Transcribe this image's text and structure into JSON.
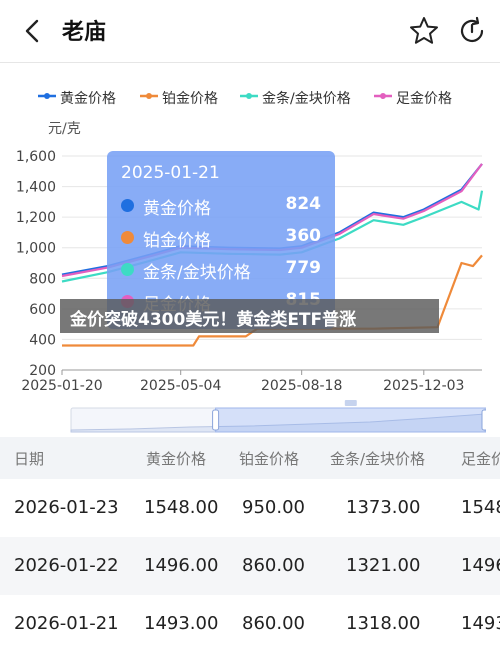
{
  "header": {
    "title": "老庙",
    "back_icon": "back-chevron-icon",
    "favorite_icon": "star-icon",
    "refresh_icon": "refresh-icon"
  },
  "legend": [
    {
      "label": "黄金价格",
      "color": "#1f6fe0"
    },
    {
      "label": "铂金价格",
      "color": "#ef8a3a"
    },
    {
      "label": "金条/金块价格",
      "color": "#3ddbc4"
    },
    {
      "label": "足金价格",
      "color": "#e35fbf"
    }
  ],
  "chart_data": {
    "type": "line",
    "ylabel": "元/克",
    "ylim": [
      200,
      1600
    ],
    "yticks": [
      "200",
      "400",
      "600",
      "800",
      "1,000",
      "1,200",
      "1,400",
      "1,600"
    ],
    "xticks": [
      "2025-01-20",
      "2025-05-04",
      "2025-08-18",
      "2025-12-03"
    ],
    "grid": true,
    "series": [
      {
        "name": "黄金价格",
        "color": "#1f6fe0",
        "x": [
          "2025-01-20",
          "2025-03-01",
          "2025-04-10",
          "2025-05-04",
          "2025-06-15",
          "2025-07-30",
          "2025-08-18",
          "2025-09-20",
          "2025-10-20",
          "2025-11-15",
          "2025-12-03",
          "2026-01-05",
          "2026-01-23"
        ],
        "values": [
          824,
          880,
          960,
          1010,
          1000,
          995,
          1010,
          1100,
          1230,
          1200,
          1250,
          1380,
          1548
        ]
      },
      {
        "name": "铂金价格",
        "color": "#ef8a3a",
        "x": [
          "2025-01-20",
          "2025-05-15",
          "2025-05-20",
          "2025-06-30",
          "2025-07-10",
          "2025-10-20",
          "2025-12-15",
          "2025-12-20",
          "2026-01-05",
          "2026-01-15",
          "2026-01-23"
        ],
        "values": [
          360,
          360,
          420,
          420,
          470,
          470,
          480,
          580,
          900,
          880,
          950
        ]
      },
      {
        "name": "金条/金块价格",
        "color": "#3ddbc4",
        "x": [
          "2025-01-20",
          "2025-03-01",
          "2025-04-10",
          "2025-05-04",
          "2025-06-15",
          "2025-07-30",
          "2025-08-18",
          "2025-09-20",
          "2025-10-20",
          "2025-11-15",
          "2025-12-03",
          "2026-01-05",
          "2026-01-20",
          "2026-01-23"
        ],
        "values": [
          779,
          840,
          920,
          970,
          960,
          955,
          970,
          1060,
          1180,
          1150,
          1200,
          1300,
          1250,
          1373
        ]
      },
      {
        "name": "足金价格",
        "color": "#e35fbf",
        "x": [
          "2025-01-20",
          "2025-03-01",
          "2025-04-10",
          "2025-05-04",
          "2025-06-15",
          "2025-07-30",
          "2025-08-18",
          "2025-09-20",
          "2025-10-20",
          "2025-11-15",
          "2025-12-03",
          "2026-01-05",
          "2026-01-23"
        ],
        "values": [
          815,
          870,
          950,
          1000,
          990,
          985,
          1000,
          1090,
          1220,
          1190,
          1240,
          1370,
          1548
        ]
      }
    ]
  },
  "tooltip": {
    "date": "2025-01-21",
    "rows": [
      {
        "label": "黄金价格",
        "value": "824",
        "color": "#1f6fe0"
      },
      {
        "label": "铂金价格",
        "value": "360",
        "color": "#ef8a3a"
      },
      {
        "label": "金条/金块价格",
        "value": "779",
        "color": "#3ddbc4"
      },
      {
        "label": "足金价格",
        "value": "815",
        "color": "#e35fbf"
      }
    ]
  },
  "banner": {
    "text": "金价突破4300美元！黄金类ETF普涨"
  },
  "zoom_slider": {
    "start": 0.35,
    "end": 1.0
  },
  "table": {
    "headers": [
      "日期",
      "黄金价格",
      "铂金价格",
      "金条/金块价格",
      "足金价"
    ],
    "rows": [
      [
        "2026-01-23",
        "1548.00",
        "950.00",
        "1373.00",
        "1548"
      ],
      [
        "2026-01-22",
        "1496.00",
        "860.00",
        "1321.00",
        "1496"
      ],
      [
        "2026-01-21",
        "1493.00",
        "860.00",
        "1318.00",
        "1493"
      ]
    ]
  }
}
